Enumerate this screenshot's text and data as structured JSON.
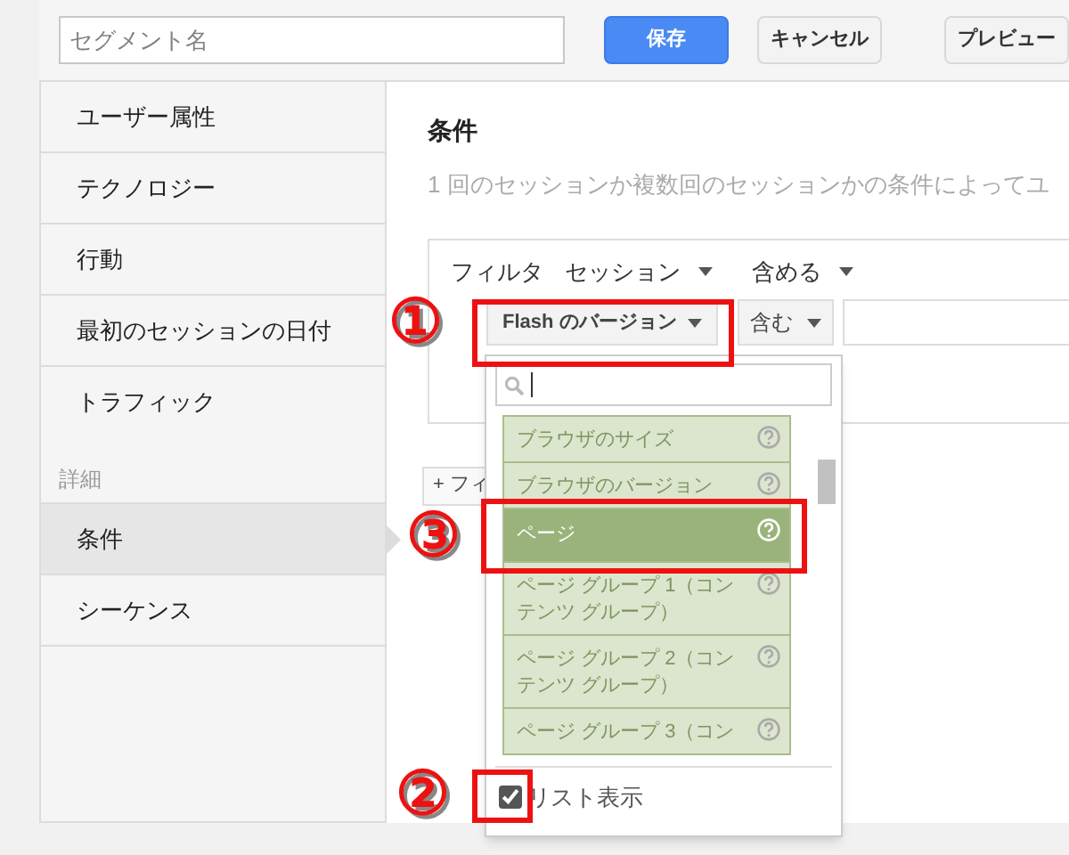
{
  "toolbar": {
    "segment_name_placeholder": "セグメント名",
    "buttons": [
      {
        "label": "保存",
        "kind": "primary"
      },
      {
        "label": "キャンセル",
        "kind": "default"
      },
      {
        "label": "プレビュー",
        "kind": "default"
      }
    ]
  },
  "sidebar": {
    "groups": [
      {
        "items": [
          {
            "label": "ユーザー属性",
            "selected": false
          },
          {
            "label": "テクノロジー",
            "selected": false
          },
          {
            "label": "行動",
            "selected": false
          },
          {
            "label": "最初のセッションの日付",
            "selected": false
          },
          {
            "label": "トラフィック",
            "selected": false
          }
        ]
      },
      {
        "heading": "詳細",
        "items": [
          {
            "label": "条件",
            "selected": true
          },
          {
            "label": "シーケンス",
            "selected": false
          }
        ]
      }
    ]
  },
  "main": {
    "title": "条件",
    "description": "1 回のセッションか複数回のセッションかの条件によってユ",
    "filter": {
      "label": "フィルタ",
      "scope": "セッション",
      "mode": "含める",
      "dimension": "Flash のバージョン",
      "operator": "含む",
      "add_filter": "+ フィ"
    }
  },
  "dropdown": {
    "items": [
      {
        "label": "ブラウザのサイズ",
        "selected": false
      },
      {
        "label": "ブラウザのバージョン",
        "selected": false
      },
      {
        "label": "ページ",
        "selected": true
      },
      {
        "label": "ページ グループ 1（コンテンツ グループ）",
        "selected": false
      },
      {
        "label": "ページ グループ 2（コンテンツ グループ）",
        "selected": false
      },
      {
        "label": "ページ グループ 3（コン",
        "selected": false
      }
    ],
    "list_view": {
      "label": "リスト表示",
      "checked": true
    }
  },
  "annotations": [
    {
      "label": "①"
    },
    {
      "label": "③"
    },
    {
      "label": "②"
    }
  ]
}
